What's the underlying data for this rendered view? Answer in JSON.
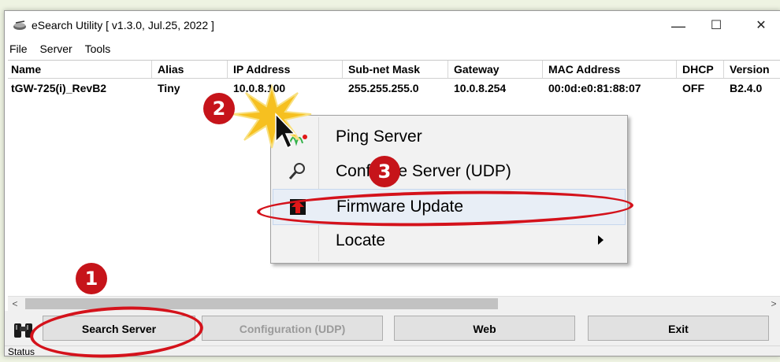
{
  "window": {
    "title": "eSearch Utility [ v1.3.0, Jul.25, 2022 ]",
    "controls": {
      "minimize": "—",
      "maximize": "☐",
      "close": "✕"
    }
  },
  "menu": [
    "File",
    "Server",
    "Tools"
  ],
  "table": {
    "columns": [
      "Name",
      "Alias",
      "IP Address",
      "Sub-net Mask",
      "Gateway",
      "MAC Address",
      "DHCP",
      "Version"
    ],
    "rows": [
      [
        "tGW-725(i)_RevB2",
        "Tiny",
        "10.0.8.100",
        "255.255.255.0",
        "10.0.8.254",
        "00:0d:e0:81:88:07",
        "OFF",
        "B2.4.0"
      ]
    ]
  },
  "context_menu": {
    "items": [
      {
        "label": "Ping Server",
        "icon": "ping-icon"
      },
      {
        "label": "Configure Server (UDP)",
        "icon": "wrench-icon"
      },
      {
        "label": "Firmware Update",
        "icon": "firmware-upload-icon"
      },
      {
        "label": "Locate",
        "icon": "submenu-arrow-icon"
      }
    ],
    "highlighted": "Firmware Update"
  },
  "toolbar": {
    "search_label": "Search Server",
    "config_label": "Configuration (UDP)",
    "web_label": "Web",
    "exit_label": "Exit"
  },
  "status": {
    "text": "Status"
  },
  "scrollbar": {
    "left_arrow": "<",
    "right_arrow": ">"
  },
  "annotations": {
    "step1": "1",
    "step2": "2",
    "step3": "3"
  },
  "colors": {
    "annotation_red": "#c6141a",
    "highlight": "#e8eef6"
  }
}
